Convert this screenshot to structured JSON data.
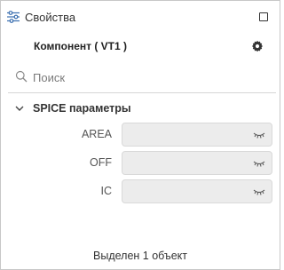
{
  "panel": {
    "title": "Свойства",
    "icons": {
      "title_icon": "sliders-icon",
      "maximize": "maximize-icon"
    }
  },
  "component": {
    "title": "Компонент ( VT1 )",
    "settings_icon": "gear-icon"
  },
  "search": {
    "placeholder": "Поиск",
    "value": ""
  },
  "section": {
    "title": "SPICE параметры",
    "expanded": true,
    "properties": [
      {
        "label": "AREA",
        "value": ""
      },
      {
        "label": "OFF",
        "value": ""
      },
      {
        "label": "IC",
        "value": ""
      }
    ]
  },
  "status": {
    "text": "Выделен 1 объект"
  },
  "colors": {
    "field_bg": "#ececec",
    "border": "#c8c8c8",
    "divider": "#d6d6d6"
  }
}
